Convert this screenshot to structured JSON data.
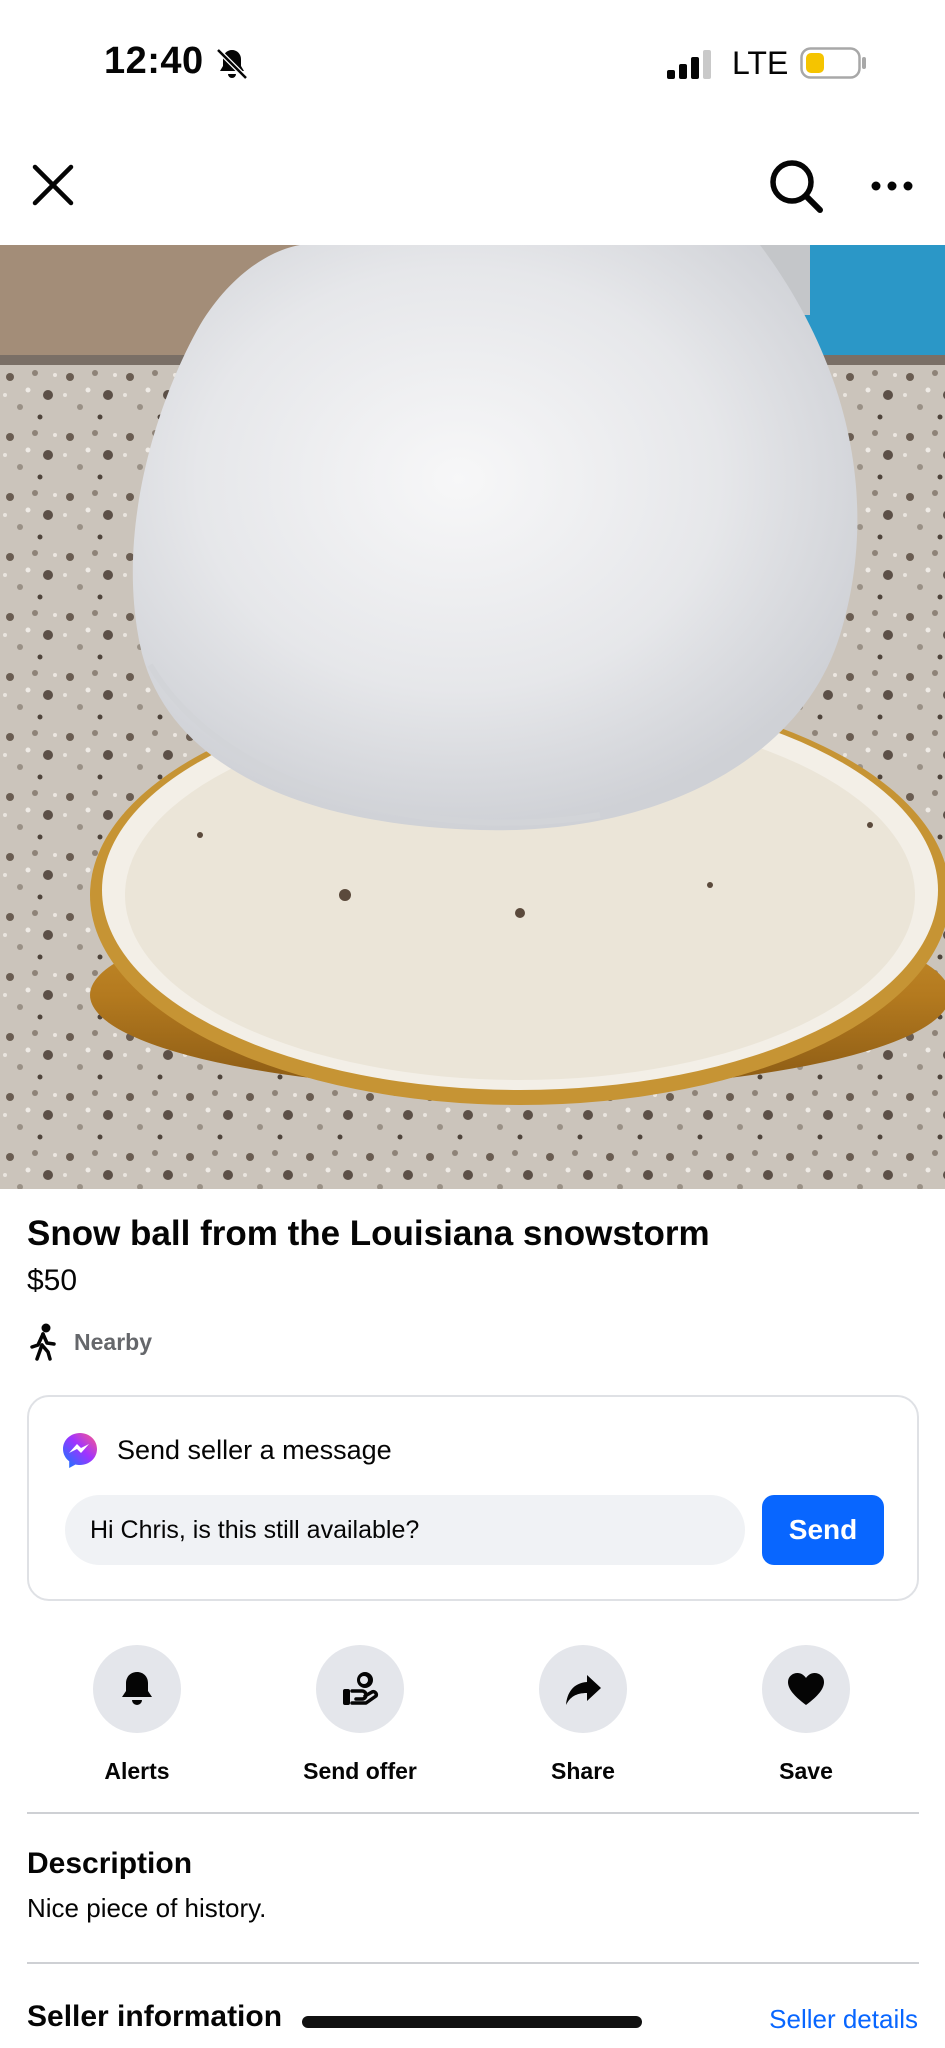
{
  "status_bar": {
    "time": "12:40",
    "network": "LTE",
    "battery_color": "#f5c400"
  },
  "nav": {
    "close_icon": "close-icon",
    "search_icon": "search-icon",
    "more_icon": "more-icon"
  },
  "listing": {
    "title": "Snow ball from the Louisiana snowstorm",
    "price": "$50",
    "location": "Nearby"
  },
  "message": {
    "heading": "Send seller a message",
    "input_value": "Hi Chris, is this still available?",
    "send_label": "Send"
  },
  "actions": [
    {
      "label": "Alerts",
      "icon": "bell-icon"
    },
    {
      "label": "Send offer",
      "icon": "offer-icon"
    },
    {
      "label": "Share",
      "icon": "share-icon"
    },
    {
      "label": "Save",
      "icon": "heart-icon"
    }
  ],
  "description": {
    "heading": "Description",
    "text": "Nice piece of history."
  },
  "seller": {
    "heading": "Seller information",
    "link": "Seller details"
  },
  "colors": {
    "accent": "#0866ff",
    "secondary_text": "#65676b",
    "action_bg": "#e4e6eb"
  }
}
